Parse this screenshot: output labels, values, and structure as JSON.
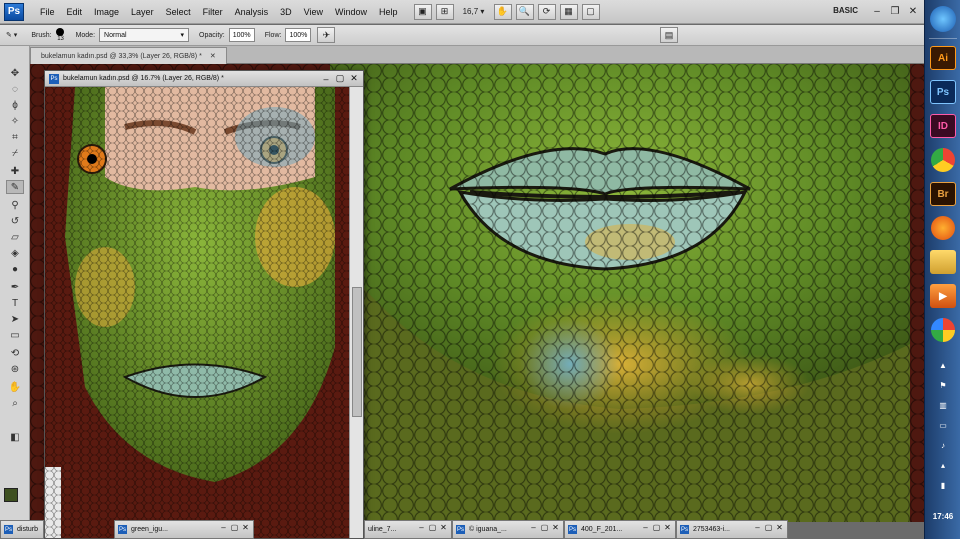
{
  "app": {
    "logo": "Ps",
    "menu": [
      "File",
      "Edit",
      "Image",
      "Layer",
      "Select",
      "Filter",
      "Analysis",
      "3D",
      "View",
      "Window",
      "Help"
    ],
    "zoom": "16,7",
    "workspace": "BASIC"
  },
  "options": {
    "brush_label": "Brush:",
    "brush_size": "13",
    "mode_label": "Mode:",
    "mode_value": "Normal",
    "opacity_label": "Opacity:",
    "opacity_value": "100%",
    "flow_label": "Flow:",
    "flow_value": "100%"
  },
  "tab_active": "bukelamun kadın.psd @ 33,3% (Layer 26, RGB/8) *",
  "float_doc_title": "bukelamun kadın.psd @ 16.7% (Layer 26, RGB/8) *",
  "mini_docs": [
    "disturb",
    "green_igu...",
    "uline_7...",
    "© iguana_...",
    "400_F_201...",
    "2753463-i..."
  ],
  "colors": {
    "foreground": "#3e5020",
    "background": "#ffffff",
    "dock_top": "#1d3d6b"
  },
  "dock_apps": [
    {
      "name": "windows-orb-icon",
      "label": ""
    },
    {
      "name": "illustrator-icon",
      "label": "Ai"
    },
    {
      "name": "photoshop-icon",
      "label": "Ps"
    },
    {
      "name": "indesign-icon",
      "label": "ID"
    },
    {
      "name": "chrome-icon",
      "label": ""
    },
    {
      "name": "bridge-icon",
      "label": "Br"
    },
    {
      "name": "firefox-icon",
      "label": ""
    },
    {
      "name": "folder-icon",
      "label": ""
    },
    {
      "name": "media-player-icon",
      "label": ""
    },
    {
      "name": "picasa-icon",
      "label": ""
    }
  ],
  "clock": "17:46"
}
